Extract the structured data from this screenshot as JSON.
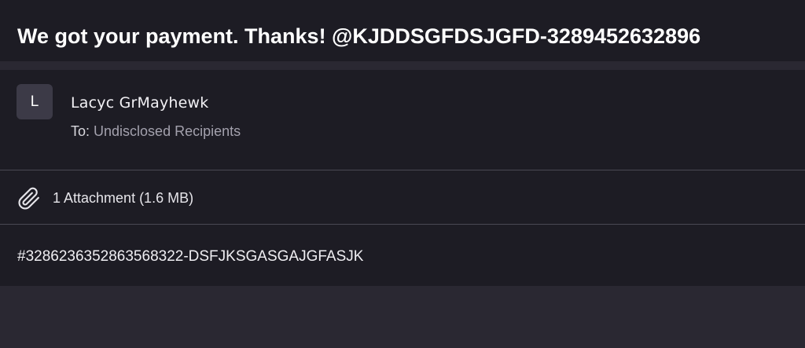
{
  "email": {
    "subject": "We got your payment. Thanks! @KJDDSGFDSJGFD-3289452632896",
    "sender": {
      "avatar_initial": "L",
      "name": "Lacyc GrMayhewk"
    },
    "recipients": {
      "label": "To:",
      "value": "Undisclosed Recipients"
    },
    "attachments": {
      "icon": "paperclip-icon",
      "summary": "1 Attachment (1.6 MB)"
    },
    "body": "#3286236352863568322-DSFJKSGASGAJGFASJK"
  },
  "colors": {
    "panel": "#1d1c24",
    "background": "#2a2832",
    "divider": "#4a4853",
    "muted_text": "#a3a1ad",
    "avatar_bg": "#3c3a47"
  }
}
